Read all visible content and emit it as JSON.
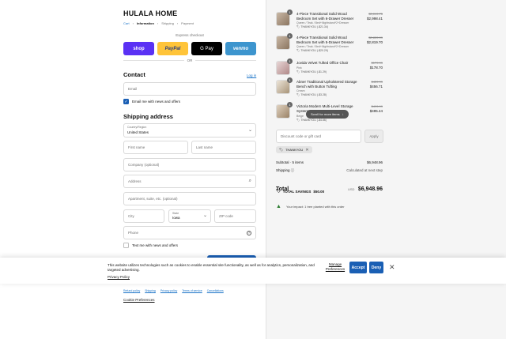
{
  "brand": "HULALA HOME",
  "breadcrumb": {
    "cart": "Cart",
    "information": "Information",
    "shipping": "Shipping",
    "payment": "Payment",
    "sep": "›"
  },
  "express": {
    "label": "Express checkout",
    "shop": "shop",
    "paypal": "PayPal",
    "gpay": "G Pay",
    "venmo": "venmo",
    "or": "OR"
  },
  "contact": {
    "heading": "Contact",
    "login": "Log in",
    "email_placeholder": "Email",
    "email_offers": "Email me with news and offers"
  },
  "shipping": {
    "heading": "Shipping address",
    "country_label": "Country/Region",
    "country_value": "United States",
    "first_name": "First name",
    "last_name": "Last name",
    "company": "Company (optional)",
    "address": "Address",
    "apartment": "Apartment, suite, etc. (optional)",
    "city": "City",
    "state_label": "State",
    "state_value": "Iowa",
    "zip": "ZIP code",
    "phone": "Phone",
    "text_offers": "Text me with news and offers"
  },
  "footer": {
    "links": [
      "Refund policy",
      "Shipping",
      "Privacy policy",
      "Terms of service",
      "Cancellations"
    ],
    "cookie_prefs": "Cookie Preferences"
  },
  "cart": {
    "items": [
      {
        "qty": "1",
        "name": "4-Piece Transitional Solid Wood Bedroom Set with 6-Drawer Dresser",
        "variant": "Queen / Teak / Bed+Nightstand*2+Dresser",
        "discount": "THANKYOU (-$21.34)",
        "old_price": "$3,019.75",
        "price": "$2,998.41"
      },
      {
        "qty": "1",
        "name": "4-Piece Transitional Solid Wood Bedroom Set with 5-Drawer Dresser",
        "variant": "Queen / Teak / Bed+Nightstand*2+Dresser",
        "discount": "THANKYOU (-$20.29)",
        "old_price": "$2,839.99",
        "price": "$2,819.70"
      },
      {
        "qty": "1",
        "name": "Jovida Velvet Tufted Office Chair",
        "variant": "Pink",
        "discount": "THANKYOU (-$1.29)",
        "old_price": "$179.99",
        "price": "$178.70"
      },
      {
        "qty": "1",
        "name": "Abner Traditional Upholstered Storage Bench with Button Tufting",
        "variant": "Cream",
        "discount": "THANKYOU (-$3.28)",
        "old_price": "$459.99",
        "price": "$456.71"
      },
      {
        "qty": "1",
        "name": "Victoria Modern Multi-Level Storage System",
        "variant": "Beige",
        "discount": "THANKYOU (-$4.66)",
        "old_price": "$499.99",
        "price": "$495.44"
      }
    ],
    "scroll_hint": "Scroll for more items",
    "discount_placeholder": "Discount code or gift card",
    "apply": "Apply",
    "code_tag": "THANKYOU",
    "subtotal_label": "Subtotal · 5 items",
    "subtotal_value": "$6,948.96",
    "shipping_label": "Shipping",
    "shipping_value": "Calculated at next step",
    "total_label": "Total",
    "currency": "USD",
    "total_value": "$6,948.96",
    "savings_label": "TOTAL SAVINGS",
    "savings_value": "$50.00",
    "impact": "Your impact: 1 tree planted with this order"
  },
  "cookie_banner": {
    "text": "This website utilizes technologies such as cookies to enable essential site functionality, as well as for analytics, personalization, and targeted advertising.",
    "policy": "Privacy Policy",
    "manage": "Manage Preferences",
    "accept": "Accept",
    "deny": "Deny",
    "close": "✕"
  },
  "colors": {
    "accent": "#1a5fb4",
    "shop": "#5a31f4",
    "paypal": "#ffc439",
    "venmo": "#3d95ce",
    "sidebar_bg": "#f5f5f5"
  }
}
